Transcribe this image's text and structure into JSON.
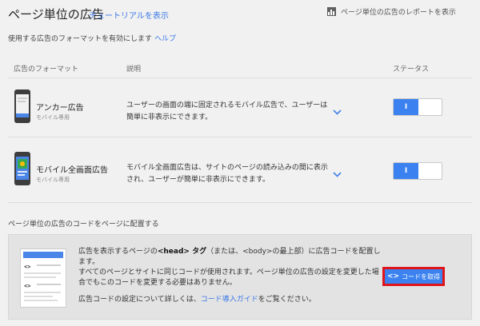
{
  "header": {
    "title": "ページ単位の広告",
    "tutorial_link": "チュートリアルを表示",
    "report_link": "ページ単位の広告のレポートを表示"
  },
  "enable": {
    "text": "使用する広告のフォーマットを有効にします",
    "help": "ヘルプ"
  },
  "table": {
    "headers": [
      "広告のフォーマット",
      "説明",
      "ステータス"
    ],
    "rows": [
      {
        "name": "アンカー広告",
        "sub": "モバイル専用",
        "description": "ユーザーの画面の端に固定されるモバイル広告で、ユーザーは簡単に非表示にできます。",
        "status_on": true,
        "toggle_label": "I"
      },
      {
        "name": "モバイル全画面広告",
        "sub": "モバイル専用",
        "description": "モバイル全画面広告は、サイトのページの読み込みの間に表示され、ユーザーが簡単に非表示にできます。",
        "status_on": true,
        "toggle_label": "I"
      }
    ]
  },
  "placement": {
    "title": "ページ単位の広告のコードをページに配置する",
    "line1_pre": "広告を表示するページの",
    "line1_head": "<head> タグ",
    "line1_mid": "（または、",
    "line1_body": "<body>",
    "line1_post": "の最上部）に広告コードを配置します。",
    "line2": "すべてのページとサイトに同じコードが使用されます。ページ単位の広告の設定を変更した場合でもこのコードを変更する必要はありません。",
    "line3_pre": "広告コードの設定について詳しくは、",
    "line3_link": "コード導入ガイド",
    "line3_post": "をご覧ください。",
    "button_icon": "<>",
    "button_label": "コードを取得"
  },
  "colors": {
    "accent": "#3b82f0",
    "link": "#3b78e7",
    "highlight_border": "#e0151a"
  }
}
